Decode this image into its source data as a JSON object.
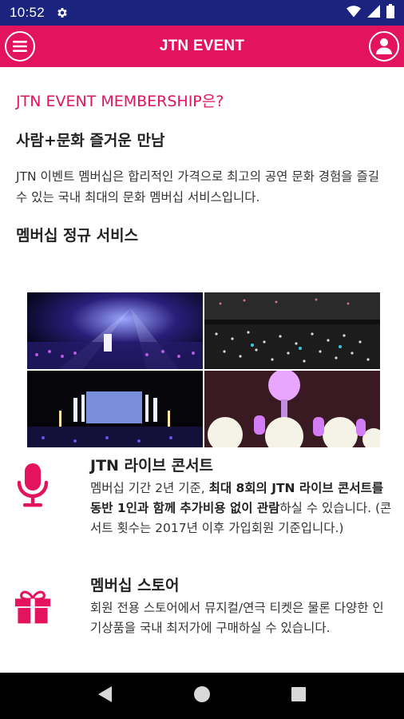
{
  "status_bar": {
    "time": "10:52",
    "icons": [
      "gear-icon",
      "wifi-icon",
      "signal-icon",
      "battery-icon"
    ]
  },
  "app_bar": {
    "title": "JTN EVENT",
    "menu_icon": "hamburger-menu-icon",
    "profile_icon": "user-profile-icon"
  },
  "intro": {
    "headline": "JTN EVENT MEMBERSHIP은?",
    "subhead": "사람+문화 즐거운 만남",
    "description": "JTN 이벤트 멤버십은 합리적인 가격으로 최고의 공연 문화 경험을 즐길 수 있는 국내 최대의 문화 멤버십 서비스입니다."
  },
  "services": {
    "title": "멤버십 정규 서비스",
    "features": [
      {
        "icon": "microphone-icon",
        "title": "JTN 라이브 콘서트",
        "desc_pre": "멤버십 기간 2년 기준, ",
        "desc_bold": "최대 8회의 JTN 라이브 콘서트를 동반 1인과 함께 추가비용 없이 관람",
        "desc_post": "하실 수 있습니다. (콘서트 횟수는 2017년 이후 가입회원 기준입니다.)"
      },
      {
        "icon": "gift-icon",
        "title": "멤버십 스토어",
        "desc": "회원 전용 스토어에서 뮤지컬/연극 티켓은 물론 다양한 인기상품을 국내 최저가에 구매하실 수 있습니다."
      }
    ]
  },
  "colors": {
    "accent": "#e3135d",
    "status_bar": "#1a237e",
    "nav_bar": "#000000"
  },
  "nav_bar": {
    "icons": [
      "back-icon",
      "home-icon",
      "recents-icon"
    ]
  }
}
